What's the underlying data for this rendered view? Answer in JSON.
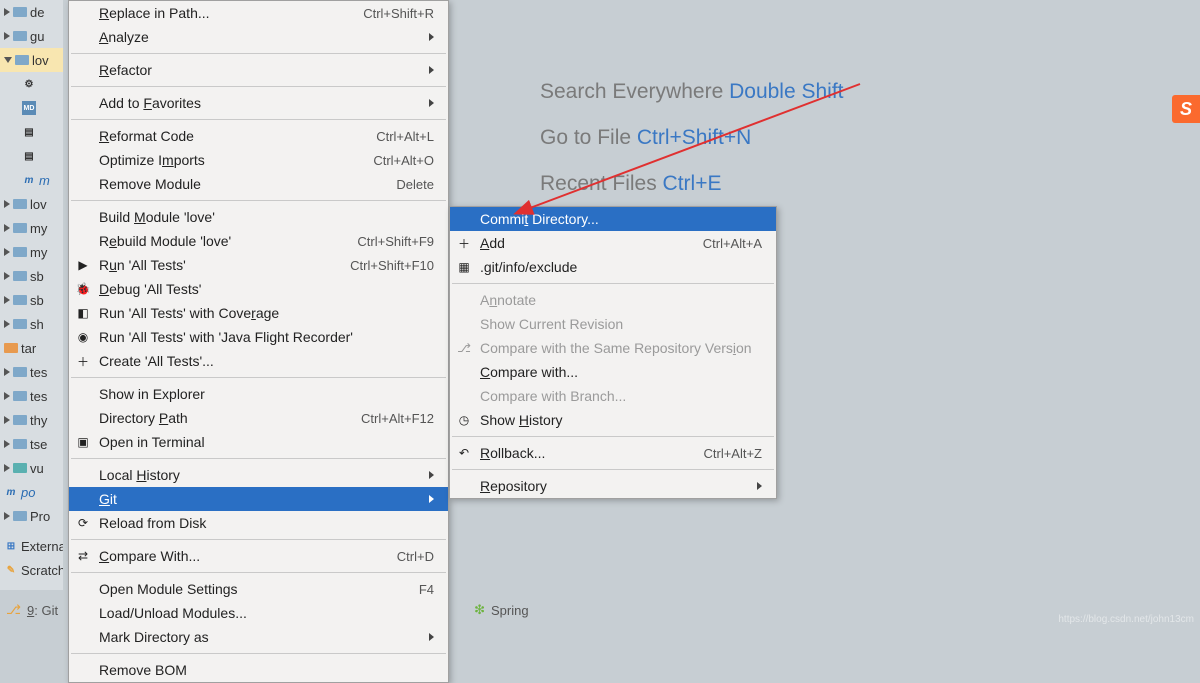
{
  "tree": [
    {
      "label": "de",
      "icon": "folder",
      "arrow": "right"
    },
    {
      "label": "gu",
      "icon": "folder",
      "arrow": "right"
    },
    {
      "label": "lov",
      "icon": "folder",
      "arrow": "down",
      "sel": true
    },
    {
      "label": "",
      "icon": "gear",
      "indent": true
    },
    {
      "label": "",
      "icon": "md",
      "indent": true
    },
    {
      "label": "",
      "icon": "file",
      "indent": true
    },
    {
      "label": "",
      "icon": "file",
      "indent": true
    },
    {
      "label": "m",
      "icon": "m-blue",
      "indent": true
    },
    {
      "label": "lov",
      "icon": "folder",
      "arrow": "right"
    },
    {
      "label": "my",
      "icon": "folder",
      "arrow": "right"
    },
    {
      "label": "my",
      "icon": "folder",
      "arrow": "right"
    },
    {
      "label": "sb",
      "icon": "folder",
      "arrow": "right"
    },
    {
      "label": "sb",
      "icon": "folder",
      "arrow": "right"
    },
    {
      "label": "sh",
      "icon": "folder",
      "arrow": "right"
    },
    {
      "label": "tar",
      "icon": "folder-orange",
      "arrow": "none"
    },
    {
      "label": "tes",
      "icon": "folder",
      "arrow": "right"
    },
    {
      "label": "tes",
      "icon": "folder",
      "arrow": "right"
    },
    {
      "label": "thy",
      "icon": "folder",
      "arrow": "right"
    },
    {
      "label": "tse",
      "icon": "folder",
      "arrow": "right"
    },
    {
      "label": "vu",
      "icon": "folder-teal",
      "arrow": "right"
    },
    {
      "label": "po",
      "icon": "m-blue",
      "arrow": "none"
    },
    {
      "label": "Pro",
      "icon": "folder",
      "arrow": "right"
    }
  ],
  "tree_extern": "External",
  "tree_scratch": "Scratches",
  "splash": [
    {
      "label": "Search Everywhere ",
      "hint": "Double Shift"
    },
    {
      "label": "Go to File ",
      "hint": "Ctrl+Shift+N"
    },
    {
      "label": "Recent Files ",
      "hint": "Ctrl+E"
    }
  ],
  "menu1": [
    {
      "type": "item",
      "label": "Replace in Path...",
      "ul": 0,
      "shortcut": "Ctrl+Shift+R"
    },
    {
      "type": "item",
      "label": "Analyze",
      "ul": 0,
      "submenu": true
    },
    {
      "type": "sep"
    },
    {
      "type": "item",
      "label": "Refactor",
      "ul": 0,
      "submenu": true
    },
    {
      "type": "sep"
    },
    {
      "type": "item",
      "label": "Add to Favorites",
      "ul": 7,
      "submenu": true
    },
    {
      "type": "sep"
    },
    {
      "type": "item",
      "label": "Reformat Code",
      "ul": 0,
      "shortcut": "Ctrl+Alt+L"
    },
    {
      "type": "item",
      "label": "Optimize Imports",
      "ul": 10,
      "shortcut": "Ctrl+Alt+O"
    },
    {
      "type": "item",
      "label": "Remove Module",
      "shortcut": "Delete"
    },
    {
      "type": "sep"
    },
    {
      "type": "item",
      "label": "Build Module 'love'",
      "ul": 6
    },
    {
      "type": "item",
      "label": "Rebuild Module 'love'",
      "ul": 1,
      "shortcut": "Ctrl+Shift+F9"
    },
    {
      "type": "item",
      "label": "Run 'All Tests'",
      "ul": 1,
      "shortcut": "Ctrl+Shift+F10",
      "icon": "run"
    },
    {
      "type": "item",
      "label": "Debug 'All Tests'",
      "ul": 0,
      "icon": "debug"
    },
    {
      "type": "item",
      "label": "Run 'All Tests' with Coverage",
      "ul": 25,
      "icon": "cov"
    },
    {
      "type": "item",
      "label": "Run 'All Tests' with 'Java Flight Recorder'",
      "icon": "jfr"
    },
    {
      "type": "item",
      "label": "Create 'All Tests'...",
      "icon": "plus"
    },
    {
      "type": "sep"
    },
    {
      "type": "item",
      "label": "Show in Explorer"
    },
    {
      "type": "item",
      "label": "Directory Path",
      "ul": 10,
      "shortcut": "Ctrl+Alt+F12"
    },
    {
      "type": "item",
      "label": "Open in Terminal",
      "icon": "term"
    },
    {
      "type": "sep"
    },
    {
      "type": "item",
      "label": "Local History",
      "ul": 6,
      "submenu": true
    },
    {
      "type": "item",
      "label": "Git",
      "ul": 0,
      "submenu": true,
      "sel": true
    },
    {
      "type": "item",
      "label": "Reload from Disk",
      "icon": "reload"
    },
    {
      "type": "sep"
    },
    {
      "type": "item",
      "label": "Compare With...",
      "ul": 0,
      "shortcut": "Ctrl+D",
      "icon": "diff"
    },
    {
      "type": "sep"
    },
    {
      "type": "item",
      "label": "Open Module Settings",
      "shortcut": "F4"
    },
    {
      "type": "item",
      "label": "Load/Unload Modules..."
    },
    {
      "type": "item",
      "label": "Mark Directory as",
      "submenu": true
    },
    {
      "type": "sep"
    },
    {
      "type": "item",
      "label": "Remove BOM"
    }
  ],
  "menu2": [
    {
      "type": "item",
      "label": "Commit Directory...",
      "ul": 5,
      "sel": true
    },
    {
      "type": "item",
      "label": "Add",
      "ul": 0,
      "shortcut": "Ctrl+Alt+A",
      "icon": "plus"
    },
    {
      "type": "item",
      "label": ".git/info/exclude",
      "icon": "gitignore"
    },
    {
      "type": "sep"
    },
    {
      "type": "item",
      "label": "Annotate",
      "ul": 1,
      "disabled": true
    },
    {
      "type": "item",
      "label": "Show Current Revision",
      "disabled": true
    },
    {
      "type": "item",
      "label": "Compare with the Same Repository Version",
      "ul": 37,
      "disabled": true,
      "icon": "branch"
    },
    {
      "type": "item",
      "label": "Compare with...",
      "ul": 0
    },
    {
      "type": "item",
      "label": "Compare with Branch...",
      "disabled": true
    },
    {
      "type": "item",
      "label": "Show History",
      "ul": 5,
      "icon": "clock"
    },
    {
      "type": "sep"
    },
    {
      "type": "item",
      "label": "Rollback...",
      "ul": 0,
      "shortcut": "Ctrl+Alt+Z",
      "icon": "rollback"
    },
    {
      "type": "sep"
    },
    {
      "type": "item",
      "label": "Repository",
      "ul": 0,
      "submenu": true
    }
  ],
  "footer_git": "9: Git",
  "footer_spring": "Spring",
  "watermark": "https://blog.csdn.net/john13cm"
}
